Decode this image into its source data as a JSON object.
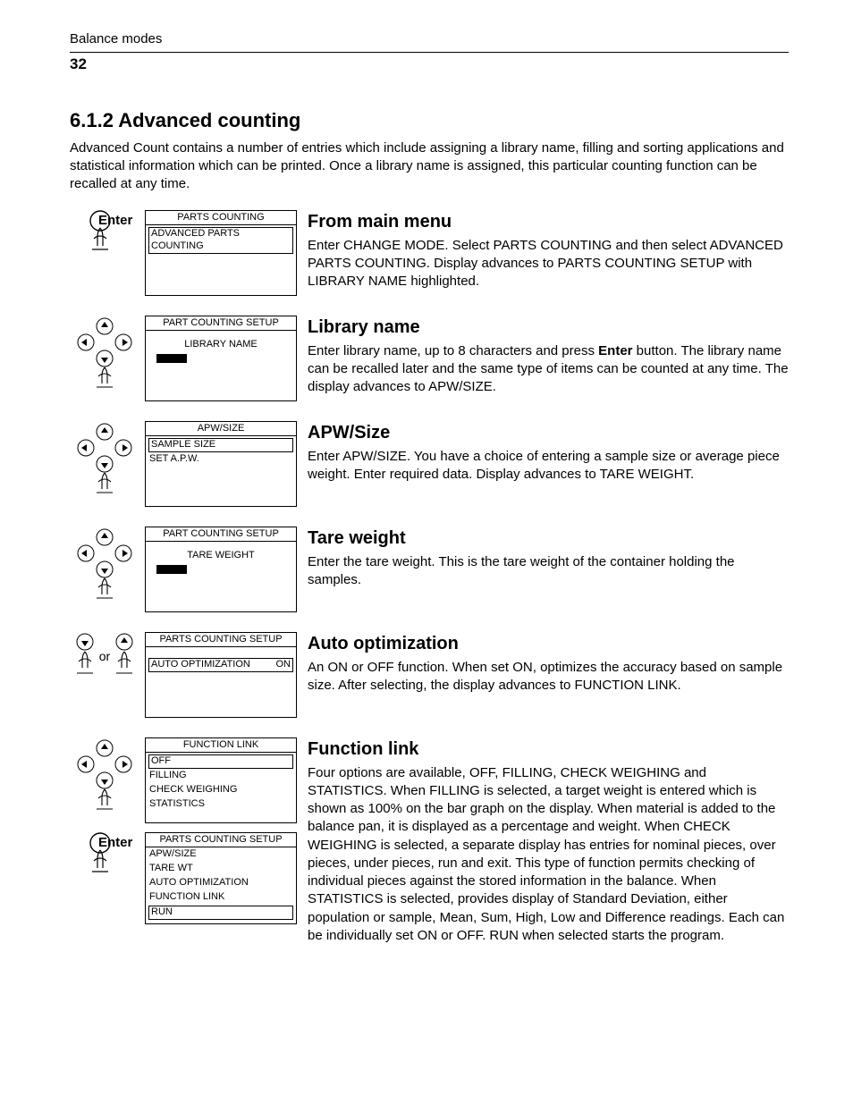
{
  "header": {
    "running": "Balance modes",
    "page": "32"
  },
  "section": {
    "number_title": "6.1.2 Advanced counting",
    "intro": "Advanced Count contains a number of entries which include assigning a library name, filling and sorting applications and statistical information which can be printed. Once a library name is assigned, this particular counting function can be recalled at any time."
  },
  "labels": {
    "enter": "Enter",
    "or": "or"
  },
  "steps": [
    {
      "icon": "enter-press",
      "screen": {
        "title": "PARTS COUNTING",
        "boxed": "ADVANCED PARTS COUNTING"
      },
      "head": "From main menu",
      "body": "Enter CHANGE MODE. Select PARTS COUNTING and then select ADVANCED PARTS COUNTING. Display advances to PARTS COUNTING SETUP with LIBRARY NAME highlighted."
    },
    {
      "icon": "dpad",
      "screen": {
        "title": "PART COUNTING SETUP",
        "center_line": "LIBRARY NAME",
        "cursor": true
      },
      "head": "Library name",
      "body_html": "Enter library name, up to 8 characters and press <b>Enter</b> button. The library name can be recalled later and the same type of items can be counted at any time. The display advances to APW/SIZE."
    },
    {
      "icon": "dpad",
      "screen": {
        "title": "APW/SIZE",
        "lines": [
          "SAMPLE SIZE",
          "SET A.P.W."
        ],
        "first_boxed": true
      },
      "head": "APW/Size",
      "body": "Enter APW/SIZE. You have a choice of entering a sample size or average piece weight. Enter required data. Display advances to TARE WEIGHT."
    },
    {
      "icon": "dpad",
      "screen": {
        "title": "PART COUNTING SETUP",
        "center_line": "TARE WEIGHT",
        "cursor": true
      },
      "head": "Tare weight",
      "body": "Enter the tare weight. This is the tare weight of the container holding the samples."
    },
    {
      "icon": "updown-or",
      "screen": {
        "title": "PARTS COUNTING SETUP",
        "row_boxed": {
          "left": "AUTO OPTIMIZATION",
          "right": "ON"
        }
      },
      "head": "Auto optimization",
      "body": "An ON or OFF function. When set ON, optimizes the accuracy based on sample size. After selecting, the display advances to FUNCTION LINK."
    },
    {
      "icon": "dpad-then-enter",
      "screens": [
        {
          "title": "FUNCTION LINK",
          "lines": [
            "OFF",
            "FILLING",
            "CHECK WEIGHING",
            "STATISTICS"
          ],
          "first_boxed": true
        },
        {
          "title": "PARTS COUNTING SETUP",
          "lines": [
            "APW/SIZE",
            "TARE WT",
            "AUTO OPTIMIZATION",
            "FUNCTION LINK",
            "RUN"
          ],
          "last_boxed": true
        }
      ],
      "head": "Function link",
      "body": "Four options are available, OFF, FILLING, CHECK WEIGHING and STATISTICS. When FILLING is selected, a target weight is entered which is shown as 100% on the bar graph on the display. When material is added to the balance pan, it is displayed as a percentage and weight. When CHECK WEIGHING is selected, a separate display has entries for nominal pieces, over pieces, under pieces, run and exit. This type of function permits checking of individual pieces against the stored information in the balance. When STATISTICS is selected, provides display of Standard Deviation, either population or sample, Mean, Sum, High, Low and Difference readings. Each can be individually set ON or OFF. RUN when selected starts the program."
    }
  ]
}
